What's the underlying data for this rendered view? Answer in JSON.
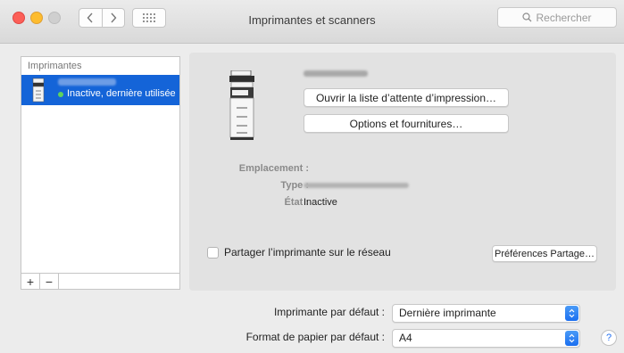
{
  "window": {
    "title": "Imprimantes et scanners",
    "search_placeholder": "Rechercher"
  },
  "printer_list": {
    "header": "Imprimantes",
    "items": [
      {
        "status": "Inactive, dernière utilisée",
        "selected": true
      }
    ],
    "add_label": "+",
    "remove_label": "−"
  },
  "detail": {
    "queue_button": "Ouvrir la liste d’attente d’impression…",
    "options_button": "Options et fournitures…",
    "location_label": "Emplacement :",
    "type_label": "Type :",
    "state_label": "État :",
    "state_value": "Inactive",
    "share_label": "Partager l’imprimante sur le réseau",
    "share_checked": false,
    "sharing_prefs_button": "Préférences Partage…"
  },
  "defaults": {
    "default_printer_label": "Imprimante par défaut :",
    "default_printer_value": "Dernière imprimante",
    "paper_size_label": "Format de papier par défaut :",
    "paper_size_value": "A4",
    "help_label": "?"
  },
  "colors": {
    "selection": "#1464d8",
    "status_dot": "#5fd35c",
    "popup_arrow": "#1b6ff0"
  },
  "icons": [
    "chevron-left-icon",
    "chevron-right-icon",
    "grid-icon",
    "search-icon",
    "printer-icon",
    "updown-icon",
    "help-icon"
  ]
}
